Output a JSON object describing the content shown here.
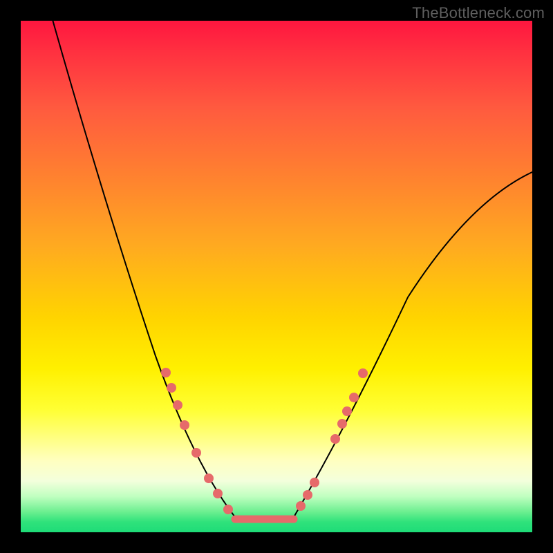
{
  "watermark": "TheBottleneck.com",
  "chart_data": {
    "type": "line",
    "title": "",
    "xlabel": "",
    "ylabel": "",
    "xlim": [
      0,
      100
    ],
    "ylim": [
      0,
      100
    ],
    "background_gradient": {
      "top": "#ff163f",
      "mid": "#ffd400",
      "bottom": "#1edc78",
      "meaning": "red-high bottleneck, green-low bottleneck"
    },
    "series": [
      {
        "name": "bottleneck-curve-left",
        "x": [
          6,
          16,
          26,
          42
        ],
        "y": [
          100,
          66,
          35,
          3
        ]
      },
      {
        "name": "trough",
        "x": [
          42,
          53
        ],
        "y": [
          2.5,
          2.5
        ]
      },
      {
        "name": "bottleneck-curve-right",
        "x": [
          53,
          63,
          76,
          100
        ],
        "y": [
          3,
          20,
          46,
          71
        ]
      }
    ],
    "points_left": [
      {
        "x": 28,
        "y": 31
      },
      {
        "x": 29,
        "y": 28
      },
      {
        "x": 31,
        "y": 25
      },
      {
        "x": 32,
        "y": 21
      },
      {
        "x": 34,
        "y": 16
      },
      {
        "x": 37,
        "y": 11
      },
      {
        "x": 39,
        "y": 8
      },
      {
        "x": 41,
        "y": 5
      }
    ],
    "points_right": [
      {
        "x": 55,
        "y": 5
      },
      {
        "x": 56,
        "y": 7
      },
      {
        "x": 57,
        "y": 10
      },
      {
        "x": 61,
        "y": 18
      },
      {
        "x": 63,
        "y": 21
      },
      {
        "x": 64,
        "y": 24
      },
      {
        "x": 65,
        "y": 26
      },
      {
        "x": 67,
        "y": 31
      }
    ],
    "point_color": "#e66a6a",
    "trough_color": "#e66a6a"
  }
}
